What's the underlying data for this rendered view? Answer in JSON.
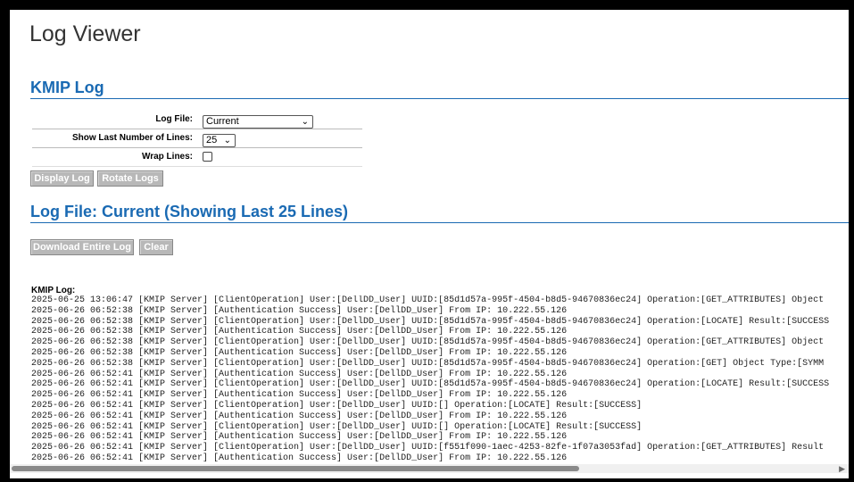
{
  "page": {
    "title": "Log Viewer"
  },
  "kmip_section": {
    "title": "KMIP Log"
  },
  "form": {
    "log_file_label": "Log File:",
    "log_file_value": "Current",
    "show_last_label": "Show Last Number of Lines:",
    "show_last_value": "25",
    "wrap_label": "Wrap Lines:"
  },
  "buttons": {
    "display_log": "Display Log",
    "rotate_logs": "Rotate Logs",
    "download_log": "Download Entire Log",
    "clear": "Clear"
  },
  "log_section": {
    "title": "Log File: Current (Showing Last 25 Lines)"
  },
  "log": {
    "label": "KMIP Log:",
    "lines": [
      "2025-06-25 13:06:47 [KMIP Server] [ClientOperation] User:[DellDD_User] UUID:[85d1d57a-995f-4504-b8d5-94670836ec24] Operation:[GET_ATTRIBUTES] Object",
      "2025-06-26 06:52:38 [KMIP Server] [Authentication Success] User:[DellDD_User] From IP: 10.222.55.126",
      "2025-06-26 06:52:38 [KMIP Server] [ClientOperation] User:[DellDD_User] UUID:[85d1d57a-995f-4504-b8d5-94670836ec24] Operation:[LOCATE] Result:[SUCCESS",
      "2025-06-26 06:52:38 [KMIP Server] [Authentication Success] User:[DellDD_User] From IP: 10.222.55.126",
      "2025-06-26 06:52:38 [KMIP Server] [ClientOperation] User:[DellDD_User] UUID:[85d1d57a-995f-4504-b8d5-94670836ec24] Operation:[GET_ATTRIBUTES] Object",
      "2025-06-26 06:52:38 [KMIP Server] [Authentication Success] User:[DellDD_User] From IP: 10.222.55.126",
      "2025-06-26 06:52:38 [KMIP Server] [ClientOperation] User:[DellDD_User] UUID:[85d1d57a-995f-4504-b8d5-94670836ec24] Operation:[GET] Object Type:[SYMM",
      "2025-06-26 06:52:41 [KMIP Server] [Authentication Success] User:[DellDD_User] From IP: 10.222.55.126",
      "2025-06-26 06:52:41 [KMIP Server] [ClientOperation] User:[DellDD_User] UUID:[85d1d57a-995f-4504-b8d5-94670836ec24] Operation:[LOCATE] Result:[SUCCESS",
      "2025-06-26 06:52:41 [KMIP Server] [Authentication Success] User:[DellDD_User] From IP: 10.222.55.126",
      "2025-06-26 06:52:41 [KMIP Server] [ClientOperation] User:[DellDD_User] UUID:[] Operation:[LOCATE] Result:[SUCCESS]",
      "2025-06-26 06:52:41 [KMIP Server] [Authentication Success] User:[DellDD_User] From IP: 10.222.55.126",
      "2025-06-26 06:52:41 [KMIP Server] [ClientOperation] User:[DellDD_User] UUID:[] Operation:[LOCATE] Result:[SUCCESS]",
      "2025-06-26 06:52:41 [KMIP Server] [Authentication Success] User:[DellDD_User] From IP: 10.222.55.126",
      "2025-06-26 06:52:41 [KMIP Server] [ClientOperation] User:[DellDD_User] UUID:[f551f090-1aec-4253-82fe-1f07a3053fad] Operation:[GET_ATTRIBUTES] Result",
      "2025-06-26 06:52:41 [KMIP Server] [Authentication Success] User:[DellDD_User] From IP: 10.222.55.126"
    ]
  },
  "icons": {
    "dropdown": "chevron-down-icon",
    "scroll_right": "arrow-right-icon"
  }
}
